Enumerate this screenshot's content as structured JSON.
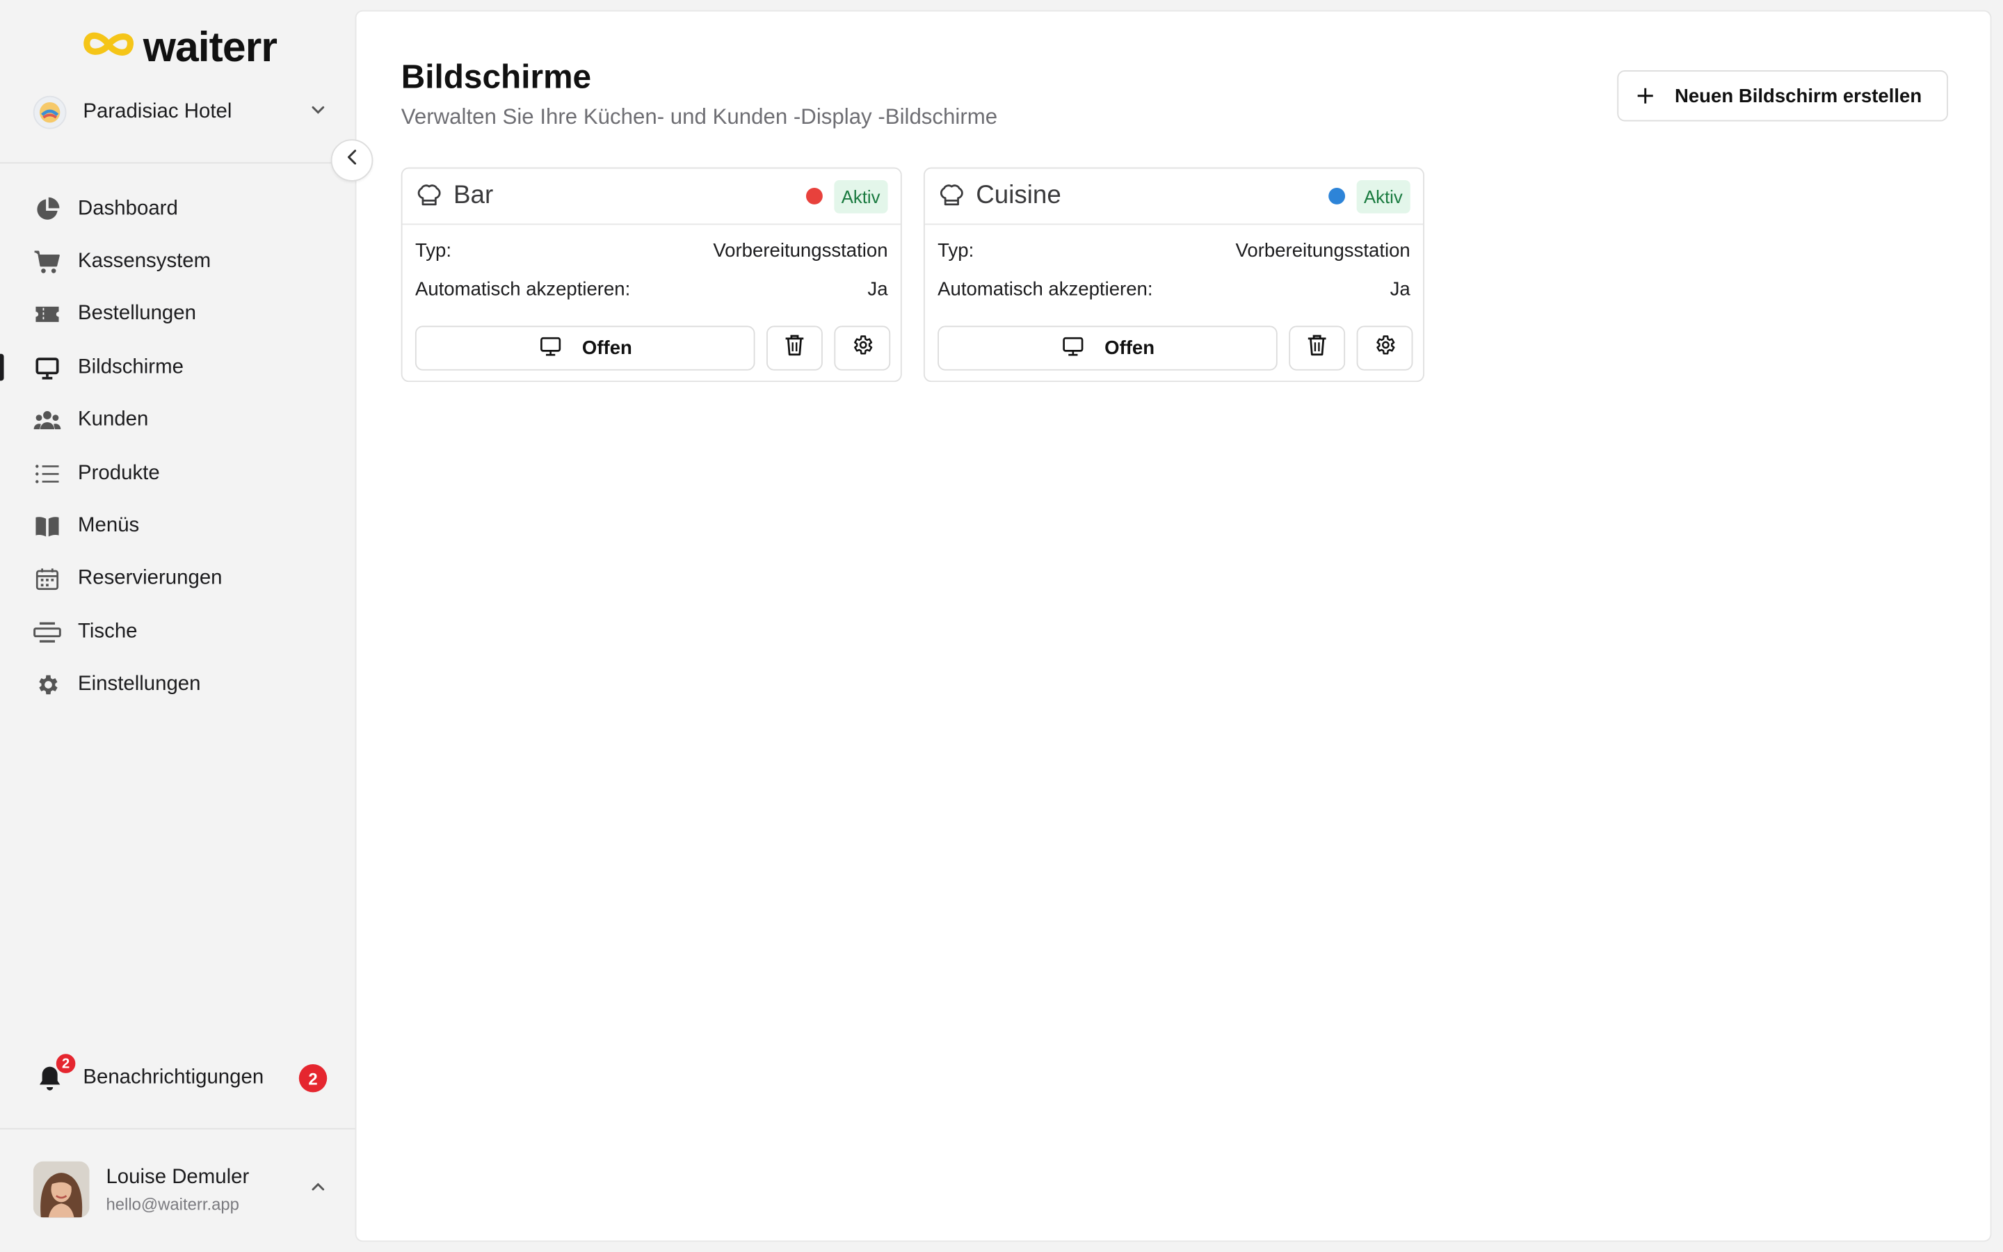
{
  "app": {
    "brand": "waiterr"
  },
  "colors": {
    "accent": "#f5c518",
    "danger": "#e5262f",
    "active_bg": "#e3f6ea",
    "active_text": "#197a3f"
  },
  "sidebar": {
    "hotel": {
      "name": "Paradisiac Hotel"
    },
    "items": [
      {
        "label": "Dashboard",
        "icon": "pie-chart-icon"
      },
      {
        "label": "Kassensystem",
        "icon": "cart-icon"
      },
      {
        "label": "Bestellungen",
        "icon": "ticket-icon"
      },
      {
        "label": "Bildschirme",
        "icon": "monitor-icon",
        "active": true
      },
      {
        "label": "Kunden",
        "icon": "users-icon"
      },
      {
        "label": "Produkte",
        "icon": "list-icon"
      },
      {
        "label": "Menüs",
        "icon": "book-icon"
      },
      {
        "label": "Reservierungen",
        "icon": "calendar-icon"
      },
      {
        "label": "Tische",
        "icon": "table-icon"
      },
      {
        "label": "Einstellungen",
        "icon": "gear-icon"
      }
    ],
    "notifications": {
      "label": "Benachrichtigungen",
      "count": "2"
    },
    "user": {
      "name": "Louise Demuler",
      "email": "hello@waiterr.app"
    }
  },
  "main": {
    "title": "Bildschirme",
    "subtitle": "Verwalten Sie Ihre Küchen- und Kunden -Display -Bildschirme",
    "new_button": "Neuen Bildschirm erstellen",
    "screens": [
      {
        "name": "Bar",
        "dot_color": "#e8413c",
        "status": "Aktiv",
        "type_label": "Typ:",
        "type_value": "Vorbereitungsstation",
        "accept_label": "Automatisch akzeptieren:",
        "accept_value": "Ja",
        "open_label": "Offen"
      },
      {
        "name": "Cuisine",
        "dot_color": "#2d84d8",
        "status": "Aktiv",
        "type_label": "Typ:",
        "type_value": "Vorbereitungsstation",
        "accept_label": "Automatisch akzeptieren:",
        "accept_value": "Ja",
        "open_label": "Offen"
      }
    ]
  }
}
